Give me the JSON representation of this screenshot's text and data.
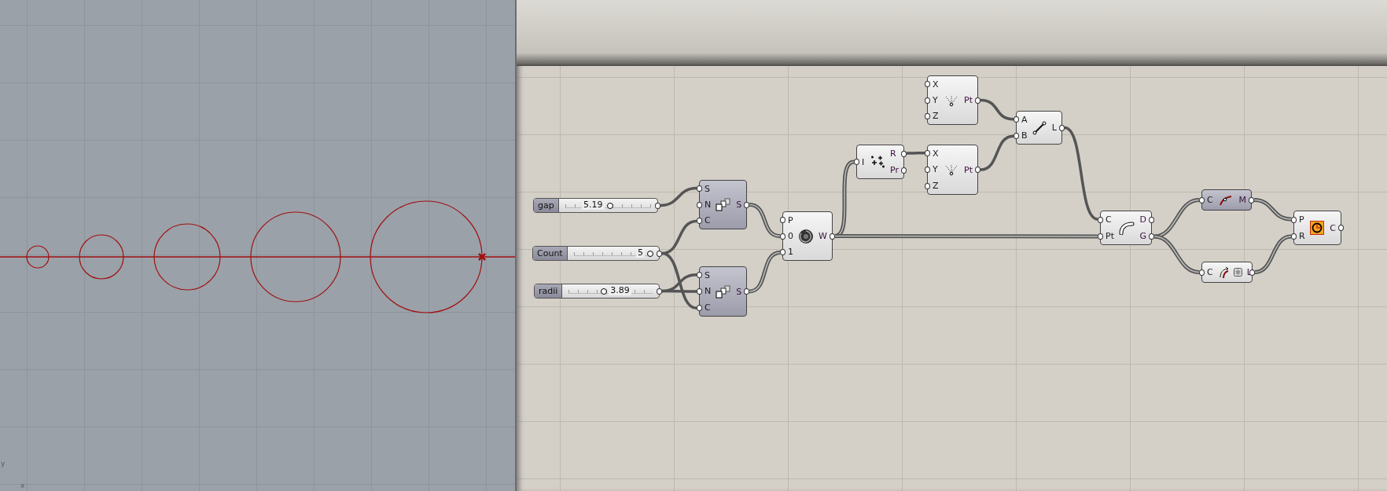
{
  "viewport": {
    "axis_labels": [
      "y",
      "x"
    ]
  },
  "sliders": [
    {
      "label": "gap",
      "value": "5.19",
      "level": 0.52
    },
    {
      "label": "Count",
      "value": "5",
      "level": 0.97
    },
    {
      "label": "radii",
      "value": "3.89",
      "level": 0.42
    }
  ],
  "components": [
    {
      "kind": "series",
      "inputs": [
        "S",
        "N",
        "C"
      ],
      "outputs": [
        "S"
      ],
      "preview_off": true
    },
    {
      "kind": "series",
      "inputs": [
        "S",
        "N",
        "C"
      ],
      "outputs": [
        "S"
      ],
      "preview_off": true
    },
    {
      "kind": "weave",
      "inputs": [
        "P",
        "0",
        "1"
      ],
      "outputs": [
        "W"
      ],
      "preview_off": false
    },
    {
      "kind": "random",
      "inputs": [
        "I"
      ],
      "outputs": [
        "R",
        "Pr"
      ],
      "preview_off": false
    },
    {
      "kind": "point",
      "inputs": [
        "X",
        "Y",
        "Z"
      ],
      "outputs": [
        "Pt"
      ],
      "preview_off": false
    },
    {
      "kind": "point",
      "inputs": [
        "X",
        "Y",
        "Z"
      ],
      "outputs": [
        "Pt"
      ],
      "preview_off": false
    },
    {
      "kind": "line",
      "inputs": [
        "A",
        "B"
      ],
      "outputs": [
        "L"
      ],
      "preview_off": false
    },
    {
      "kind": "curve",
      "inputs": [
        "C",
        "Pt"
      ],
      "outputs": [
        "D",
        "G"
      ],
      "preview_off": false
    },
    {
      "kind": "mid",
      "inputs": [
        "C"
      ],
      "outputs": [
        "M"
      ],
      "preview_off": true
    },
    {
      "kind": "length",
      "inputs": [
        "C"
      ],
      "outputs": [
        "L"
      ],
      "preview_off": false
    },
    {
      "kind": "circle",
      "inputs": [
        "P",
        "R"
      ],
      "outputs": [
        "C"
      ],
      "preview_off": false
    }
  ]
}
